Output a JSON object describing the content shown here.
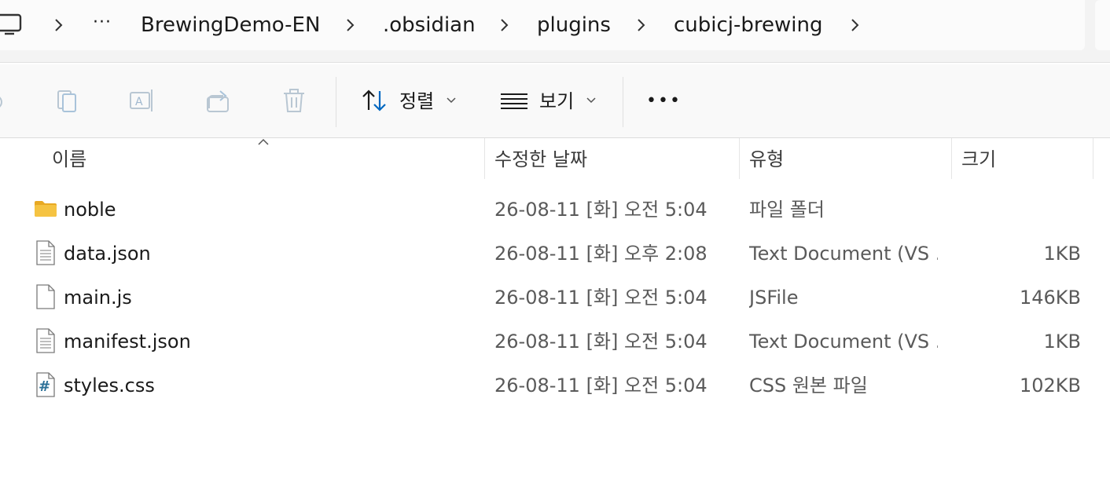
{
  "breadcrumb": {
    "ellipsis": "···",
    "items": [
      "BrewingDemo-EN",
      ".obsidian",
      "plugins",
      "cubicj-brewing"
    ]
  },
  "toolbar": {
    "sort_label": "정렬",
    "view_label": "보기",
    "more_label": "•••",
    "icons": [
      "copy-icon",
      "paste-icon",
      "rename-icon",
      "share-icon",
      "delete-icon",
      "sort-icon",
      "view-icon",
      "more-icon"
    ]
  },
  "columns": {
    "name": "이름",
    "modified": "수정한 날짜",
    "type": "유형",
    "size": "크기"
  },
  "files": [
    {
      "name": "noble",
      "modified": "26-08-11 [화] 오전 5:04",
      "type": "파일 폴더",
      "size": "",
      "icon": "folder-icon"
    },
    {
      "name": "data.json",
      "modified": "26-08-11 [화] 오후 2:08",
      "type": "Text Document (VS ...",
      "size": "1KB",
      "icon": "text-file-icon"
    },
    {
      "name": "main.js",
      "modified": "26-08-11 [화] 오전 5:04",
      "type": "JSFile",
      "size": "146KB",
      "icon": "blank-file-icon"
    },
    {
      "name": "manifest.json",
      "modified": "26-08-11 [화] 오전 5:04",
      "type": "Text Document (VS ...",
      "size": "1KB",
      "icon": "text-file-icon"
    },
    {
      "name": "styles.css",
      "modified": "26-08-11 [화] 오전 5:04",
      "type": "CSS 원본 파일",
      "size": "102KB",
      "icon": "css-file-icon"
    }
  ],
  "colors": {
    "folder": "#f5c342",
    "accent": "#0067c0",
    "css_icon": "#2a6f97"
  }
}
